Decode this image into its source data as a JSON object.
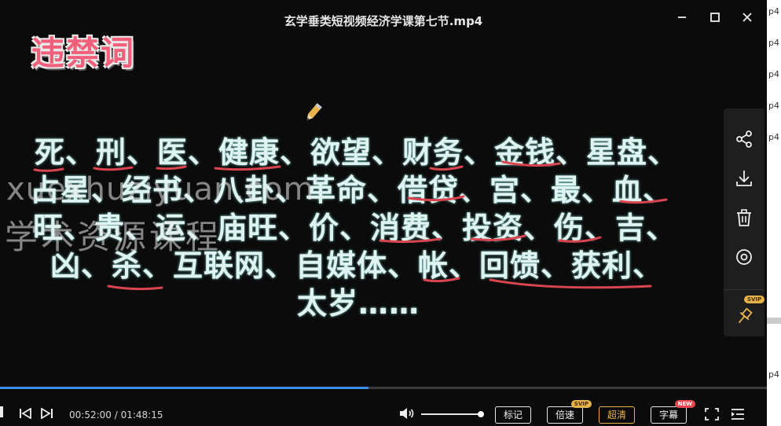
{
  "window": {
    "title": "玄学垂类短视频经济学课第七节.mp4"
  },
  "slide": {
    "heading": "违禁词",
    "lines": [
      "死、刑、医、健康、欲望、财务、金钱、星盘、",
      "占星、经书、八卦、革命、借贷、宫、最、血、",
      "旺、贵、运、庙旺、价、消费、投资、伤、吉、",
      "凶、杀、互联网、自媒体、帐、回馈、获利、",
      "太岁……"
    ]
  },
  "watermark": {
    "line1": "xuexhuziyuan.com",
    "line2": "学术资源课程"
  },
  "right_strip": {
    "items": [
      "p4",
      "p4",
      "p4",
      "p4",
      "p4",
      "p4"
    ]
  },
  "playback": {
    "current_time": "00:52:00",
    "separator": " / ",
    "total_time": "01:48:15",
    "progress_fraction": 0.4804,
    "volume_fraction": 1.0
  },
  "controls": {
    "mark_label": "标记",
    "speed_label": "倍速",
    "quality_label": "超清",
    "subtitle_label": "字幕",
    "svip_tag": "SVIP",
    "new_tag": "NEW"
  },
  "side_panel": {
    "pin_tag": "SVIP"
  },
  "colors": {
    "accent": "#3b8ee8",
    "gold": "#e7b24a",
    "heading": "#f0607a",
    "underline": "#d8454f"
  },
  "icons": [
    "close-icon",
    "maximize-icon",
    "minimize-icon",
    "share-icon",
    "download-icon",
    "delete-icon",
    "target-icon",
    "pin-icon",
    "previous-icon",
    "next-icon",
    "volume-icon",
    "fullscreen-icon",
    "playlist-icon",
    "pencil-icon"
  ]
}
